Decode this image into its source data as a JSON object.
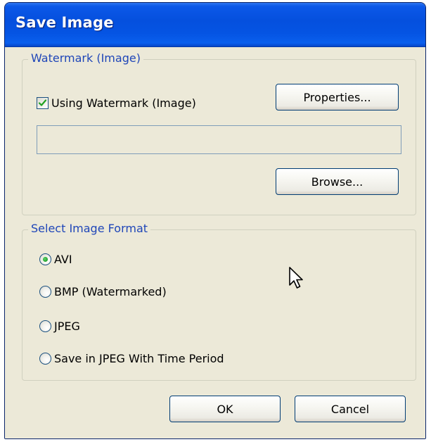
{
  "window": {
    "title": "Save Image"
  },
  "watermark_group": {
    "legend": "Watermark (Image)",
    "checkbox_label": "Using Watermark (Image)",
    "checkbox_checked": true,
    "properties_label": "Properties...",
    "path_value": "",
    "browse_label": "Browse..."
  },
  "format_group": {
    "legend": "Select Image Format",
    "options": [
      {
        "label": "AVI",
        "selected": true
      },
      {
        "label": "BMP (Watermarked)",
        "selected": false
      },
      {
        "label": "JPEG",
        "selected": false
      },
      {
        "label": "Save in JPEG With Time Period",
        "selected": false
      }
    ]
  },
  "footer": {
    "ok_label": "OK",
    "cancel_label": "Cancel"
  },
  "colors": {
    "titlebar": "#0550de",
    "dialog_bg": "#ece9d8",
    "legend_text": "#1f46b8",
    "check_mark": "#21a121"
  },
  "icons": {
    "checkbox": "check-icon",
    "pointer": "mouse-pointer-icon"
  }
}
